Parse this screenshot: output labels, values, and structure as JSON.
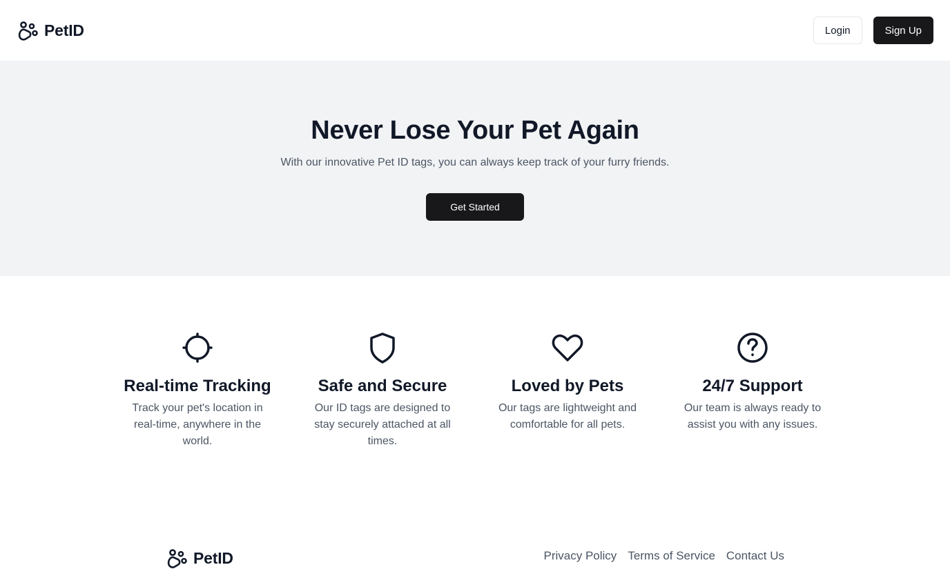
{
  "header": {
    "brand": "PetID",
    "login_label": "Login",
    "signup_label": "Sign Up"
  },
  "hero": {
    "title": "Never Lose Your Pet Again",
    "subtitle": "With our innovative Pet ID tags, you can always keep track of your furry friends.",
    "cta_label": "Get Started"
  },
  "features": [
    {
      "icon": "crosshair-icon",
      "title": "Real-time Tracking",
      "description": "Track your pet's location in real-time, anywhere in the world."
    },
    {
      "icon": "shield-icon",
      "title": "Safe and Secure",
      "description": "Our ID tags are designed to stay securely attached at all times."
    },
    {
      "icon": "heart-icon",
      "title": "Loved by Pets",
      "description": "Our tags are lightweight and comfortable for all pets."
    },
    {
      "icon": "help-circle-icon",
      "title": "24/7 Support",
      "description": "Our team is always ready to assist you with any issues."
    }
  ],
  "footer": {
    "brand": "PetID",
    "links": [
      "Privacy Policy",
      "Terms of Service",
      "Contact Us"
    ]
  },
  "colors": {
    "text_dark": "#111827",
    "text_muted": "#4b5563",
    "hero_bg": "#f2f3f5",
    "button_dark": "#18181b"
  }
}
